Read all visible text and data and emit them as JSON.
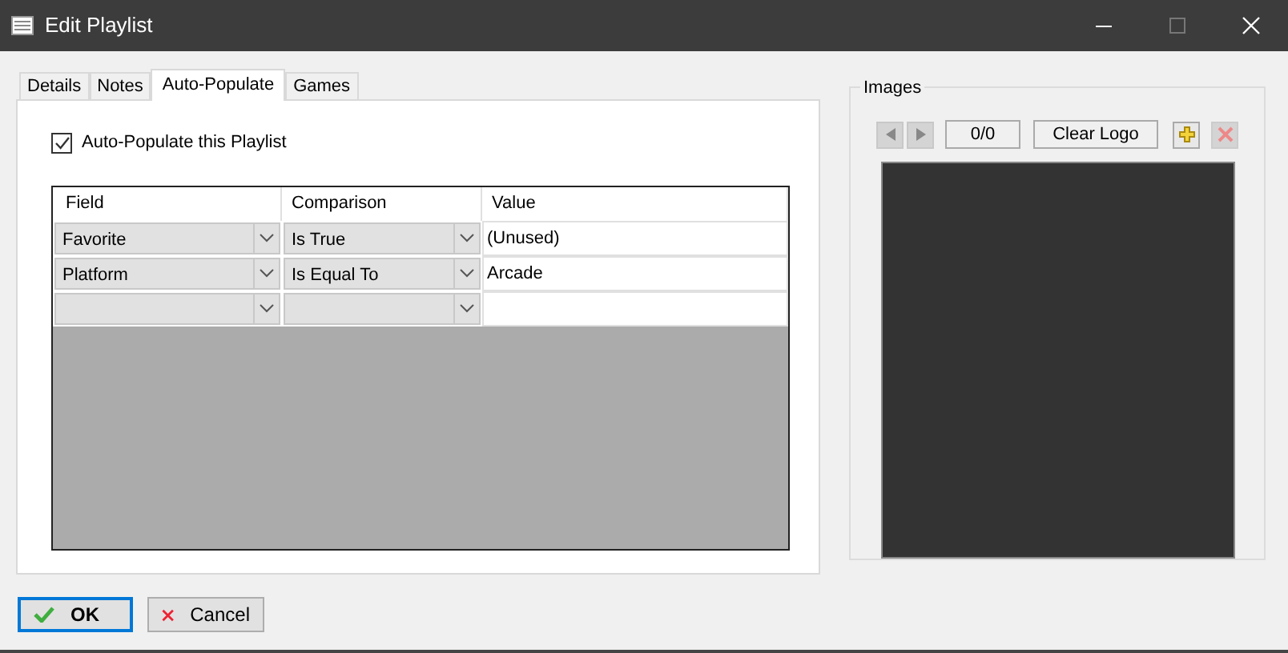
{
  "window": {
    "title": "Edit Playlist"
  },
  "tabs": [
    {
      "label": "Details",
      "selected": false
    },
    {
      "label": "Notes",
      "selected": false
    },
    {
      "label": "Auto-Populate",
      "selected": true
    },
    {
      "label": "Games",
      "selected": false
    }
  ],
  "auto_populate": {
    "label": "Auto-Populate this Playlist",
    "checked": true
  },
  "grid": {
    "columns": [
      "Field",
      "Comparison",
      "Value"
    ],
    "rows": [
      {
        "field": "Favorite",
        "comparison": "Is True",
        "value": "(Unused)"
      },
      {
        "field": "Platform",
        "comparison": "Is Equal To",
        "value": "Arcade"
      },
      {
        "field": "",
        "comparison": "",
        "value": ""
      }
    ]
  },
  "images": {
    "title": "Images",
    "counter": "0/0",
    "type": "Clear Logo"
  },
  "buttons": [
    {
      "label": "OK",
      "kind": "ok"
    },
    {
      "label": "Cancel",
      "kind": "cancel"
    }
  ]
}
